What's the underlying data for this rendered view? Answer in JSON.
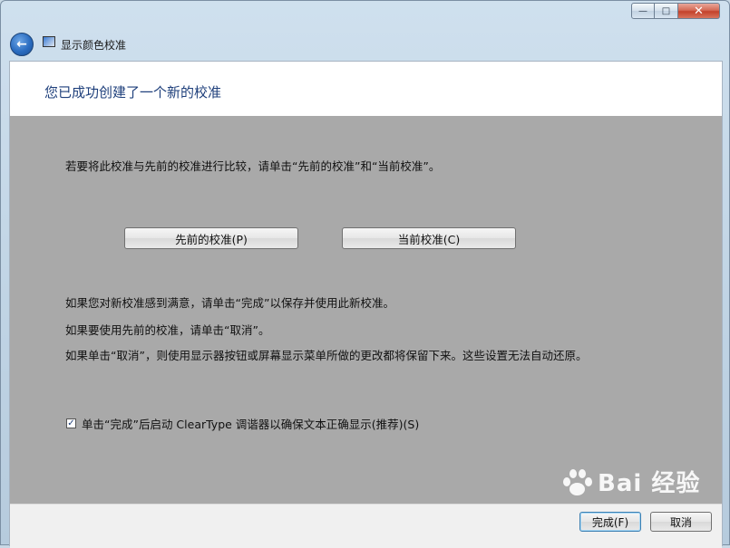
{
  "window": {
    "title": "显示颜色校准",
    "controls": {
      "minimize": "—",
      "maximize": "□",
      "close": "✕"
    }
  },
  "nav": {
    "back_icon": "back-arrow-icon"
  },
  "header": {
    "heading": "您已成功创建了一个新的校准"
  },
  "content": {
    "intro": "若要将此校准与先前的校准进行比较，请单击“先前的校准”和“当前校准”。",
    "buttons": {
      "previous": "先前的校准(P)",
      "current": "当前校准(C)"
    },
    "notes": [
      "如果您对新校准感到满意，请单击“完成”以保存并使用此新校准。",
      "如果要使用先前的校准，请单击“取消”。",
      "如果单击“取消”，则使用显示器按钮或屏幕显示菜单所做的更改都将保留下来。这些设置无法自动还原。"
    ],
    "cleartype": {
      "label": "单击“完成”后启动 ClearType 调谐器以确保文本正确显示(推荐)(S)",
      "checked": true,
      "mark": "✓"
    }
  },
  "footer": {
    "finish": "完成(F)",
    "cancel": "取消"
  },
  "watermark": {
    "text": "Bai 经验"
  }
}
